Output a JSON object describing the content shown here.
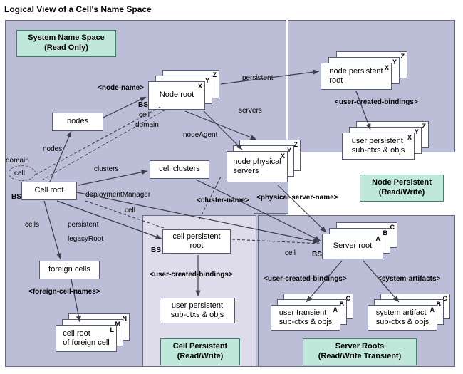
{
  "title": "Logical View of a Cell's Name Space",
  "panels": {
    "system": "System Name Space\n(Read Only)",
    "node": "Node Persistent\n(Read/Write)",
    "cell": "Cell Persistent\n(Read/Write)",
    "server": "Server Roots\n(Read/Write Transient)"
  },
  "boxes": {
    "nodes": "nodes",
    "nodeRoot": "Node root",
    "cellClusters": "cell clusters",
    "nodePhysicalServers": "node physical\nservers",
    "cellRoot": "Cell root",
    "foreignCells": "foreign cells",
    "cellRootForeign": "cell root\nof foreign cell",
    "cellPersistentRoot": "cell persistent\nroot",
    "userPersistentCP": "user persistent\nsub-ctxs & objs",
    "nodePersistentRoot": "node persistent\nroot",
    "userPersistentNP": "user persistent\nsub-ctxs & objs",
    "serverRoot": "Server root",
    "userTransient": "user transient\nsub-ctxs & objs",
    "systemArtifact": "system artifact\nsub-ctxs & objs"
  },
  "corners": {
    "xyz": [
      "X",
      "Y",
      "Z"
    ],
    "abc": [
      "A",
      "B",
      "C"
    ],
    "lmn": [
      "L",
      "M",
      "N"
    ]
  },
  "edges": {
    "nodeName": "<node-name>",
    "nodesLbl": "nodes",
    "clusters": "clusters",
    "deploymentManager": "deploymentManager",
    "cells": "cells",
    "persistent1": "persistent",
    "persistentTop": "persistent",
    "legacyRoot": "legacyRoot",
    "cellLbl": "cell",
    "domainLbl": "domain",
    "domainCell": "cell",
    "servers": "servers",
    "nodeAgent": "nodeAgent",
    "clusterName": "<cluster-name>",
    "physicalServerName": "<physical-server-name>",
    "userCreatedBindings": "<user-created-bindings>",
    "systemArtifacts": "<system-artifacts>",
    "foreignCellNames": "<foreign-cell-names>",
    "cell2": "cell"
  },
  "marks": {
    "bs": "BS"
  }
}
